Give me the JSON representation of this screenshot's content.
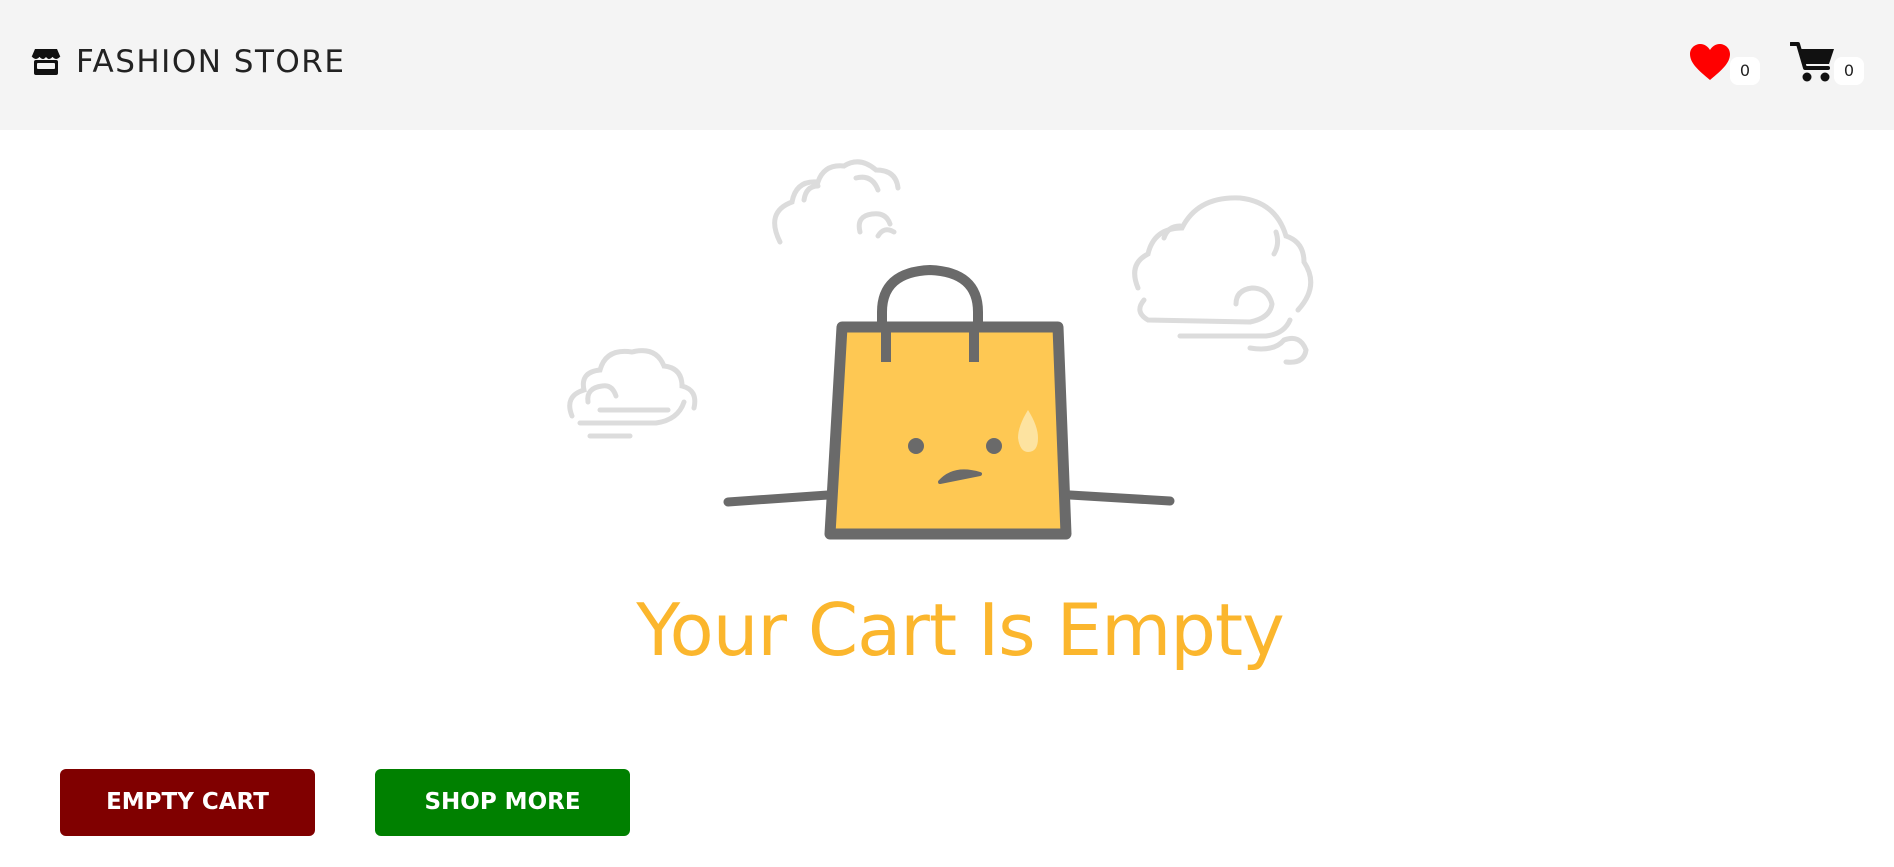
{
  "header": {
    "brand_icon": "store-icon",
    "brand_name": "FASHION STORE",
    "wishlist": {
      "icon": "heart-icon",
      "count": "0",
      "color": "#ff0000"
    },
    "cart": {
      "icon": "cart-icon",
      "count": "0",
      "color": "#111111"
    }
  },
  "main": {
    "illustration": "sad-shopping-bag-with-clouds",
    "message": "Your Cart Is Empty",
    "message_color": "#fbb62d"
  },
  "actions": {
    "empty_cart_label": "EMPTY CART",
    "empty_cart_color": "#800000",
    "shop_more_label": "SHOP MORE",
    "shop_more_color": "#008000"
  }
}
